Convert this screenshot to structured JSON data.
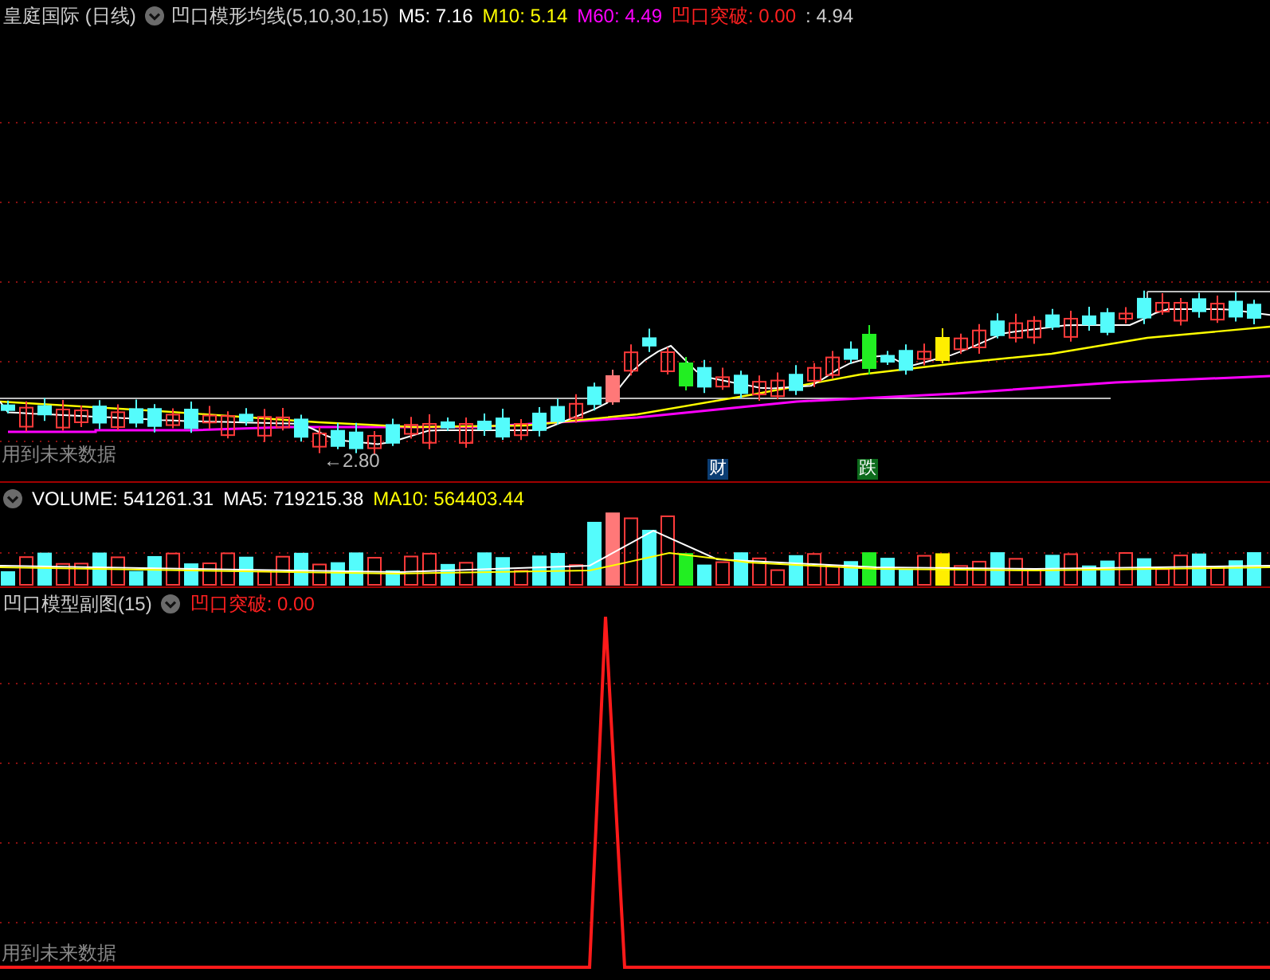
{
  "main_panel": {
    "title": "皇庭国际 (日线)",
    "indicator": "凹口模形均线(5,10,30,15)",
    "readings": [
      {
        "text": "M5: 7.16",
        "color": "#ffffff"
      },
      {
        "text": "M10: 5.14",
        "color": "#ffff00"
      },
      {
        "text": "M60: 4.49",
        "color": "#ff00ff"
      },
      {
        "text": "凹口突破: 0.00",
        "color": "#ff2020"
      },
      {
        "text": ": 4.94",
        "color": "#cccccc"
      }
    ],
    "low_label": "←2.80",
    "note": "用到未来数据",
    "markers": [
      {
        "text": "财",
        "color": "#0b3d73"
      },
      {
        "text": "跌",
        "color": "#0d6b1c"
      }
    ]
  },
  "volume_panel": {
    "readings": [
      {
        "text": "VOLUME: 541261.31",
        "color": "#ffffff"
      },
      {
        "text": "MA5: 719215.38",
        "color": "#ffffff"
      },
      {
        "text": "MA10: 564403.44",
        "color": "#ffff00"
      }
    ]
  },
  "sub_panel": {
    "title": "凹口模型副图(15)",
    "readings": [
      {
        "text": "凹口突破: 0.00",
        "color": "#ff2020"
      }
    ],
    "note": "用到未来数据"
  }
}
